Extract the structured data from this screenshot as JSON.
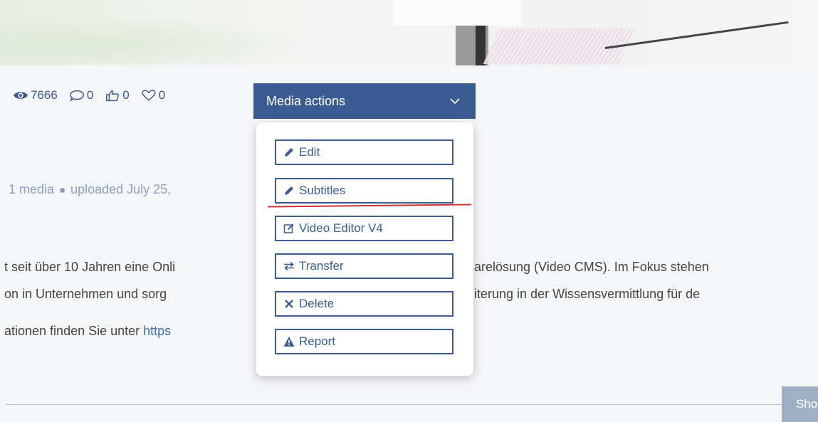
{
  "stats": {
    "views": "7666",
    "comments": "0",
    "likes": "0",
    "favorites": "0"
  },
  "media_actions": {
    "label": "Media actions",
    "items": [
      {
        "label": "Edit",
        "icon": "pencil-icon"
      },
      {
        "label": "Subtitles",
        "icon": "pencil-icon"
      },
      {
        "label": "Video Editor V4",
        "icon": "edit-square-icon"
      },
      {
        "label": "Transfer",
        "icon": "transfer-arrows-icon"
      },
      {
        "label": "Delete",
        "icon": "x-icon"
      },
      {
        "label": "Report",
        "icon": "warning-icon"
      }
    ]
  },
  "meta": {
    "count": "1 media",
    "uploaded": "uploaded July 25,"
  },
  "description": {
    "line1_left": "t seit über 10 Jahren eine Onli",
    "line1_right": "arelösung (Video CMS). Im Fokus stehen",
    "line2_left": "on in Unternehmen und sorg",
    "line2_right": "iterung in der Wissensvermittlung für de",
    "line3_left": "ationen finden Sie unter ",
    "line3_link": "https"
  },
  "show_button": "Sho",
  "colors": {
    "accent": "#3b5b93",
    "link": "#3b6fb0",
    "meta": "#8ba0c0",
    "annotation_red": "#c8323a"
  }
}
